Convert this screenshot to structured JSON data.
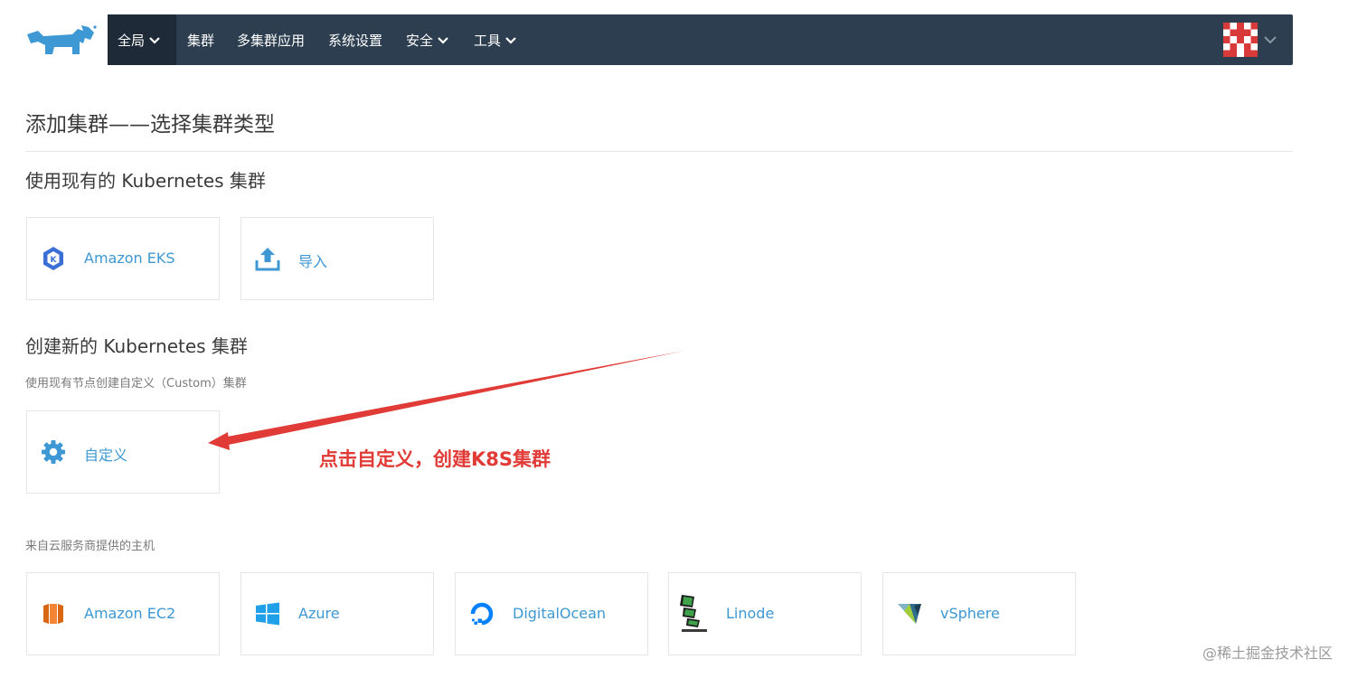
{
  "nav": {
    "items": [
      {
        "label": "全局",
        "has_dropdown": true,
        "active": true
      },
      {
        "label": "集群",
        "has_dropdown": false,
        "active": false
      },
      {
        "label": "多集群应用",
        "has_dropdown": false,
        "active": false
      },
      {
        "label": "系统设置",
        "has_dropdown": false,
        "active": false
      },
      {
        "label": "安全",
        "has_dropdown": true,
        "active": false
      },
      {
        "label": "工具",
        "has_dropdown": true,
        "active": false
      }
    ],
    "bg_color": "#2d3e50"
  },
  "page": {
    "title": "添加集群——选择集群类型"
  },
  "sections": {
    "existing": {
      "title": "使用现有的 Kubernetes 集群",
      "tiles": [
        {
          "label": "Amazon EKS",
          "icon": "eks-icon"
        },
        {
          "label": "导入",
          "icon": "upload-icon"
        }
      ]
    },
    "create": {
      "title": "创建新的 Kubernetes 集群",
      "subtitle": "使用现有节点创建自定义（Custom）集群",
      "tiles": [
        {
          "label": "自定义",
          "icon": "gear-icon"
        }
      ]
    },
    "cloud": {
      "subtitle": "来自云服务商提供的主机",
      "tiles": [
        {
          "label": "Amazon EC2",
          "icon": "ec2-icon"
        },
        {
          "label": "Azure",
          "icon": "windows-icon"
        },
        {
          "label": "DigitalOcean",
          "icon": "digitalocean-icon"
        },
        {
          "label": "Linode",
          "icon": "linode-icon"
        },
        {
          "label": "vSphere",
          "icon": "vsphere-icon"
        }
      ]
    }
  },
  "annotation": {
    "text": "点击自定义，创建K8S集群",
    "color": "#e03b36"
  },
  "watermark": "@稀土掘金技术社区",
  "colors": {
    "link": "#3d98d3",
    "accent": "#3d98d3"
  }
}
